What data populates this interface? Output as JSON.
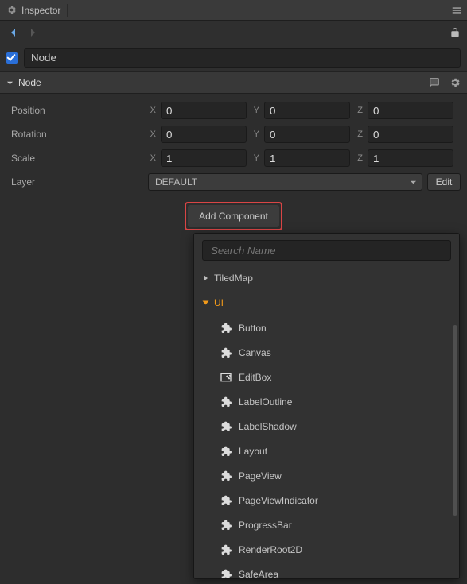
{
  "titlebar": {
    "title": "Inspector"
  },
  "node_name": "Node",
  "node_checked": true,
  "section": {
    "title": "Node"
  },
  "props": {
    "position": {
      "label": "Position",
      "x": "0",
      "y": "0",
      "z": "0"
    },
    "rotation": {
      "label": "Rotation",
      "x": "0",
      "y": "0",
      "z": "0"
    },
    "scale": {
      "label": "Scale",
      "x": "1",
      "y": "1",
      "z": "1"
    }
  },
  "axis_labels": {
    "x": "X",
    "y": "Y",
    "z": "Z"
  },
  "layer": {
    "label": "Layer",
    "value": "DEFAULT",
    "edit": "Edit"
  },
  "add_component_label": "Add Component",
  "dropdown": {
    "search_placeholder": "Search Name",
    "categories": {
      "tiledmap": "TiledMap",
      "ui": "UI"
    },
    "ui_items": [
      "Button",
      "Canvas",
      "EditBox",
      "LabelOutline",
      "LabelShadow",
      "Layout",
      "PageView",
      "PageViewIndicator",
      "ProgressBar",
      "RenderRoot2D",
      "SafeArea"
    ],
    "icons": {
      "default": "puzzle",
      "EditBox": "editbox"
    }
  }
}
